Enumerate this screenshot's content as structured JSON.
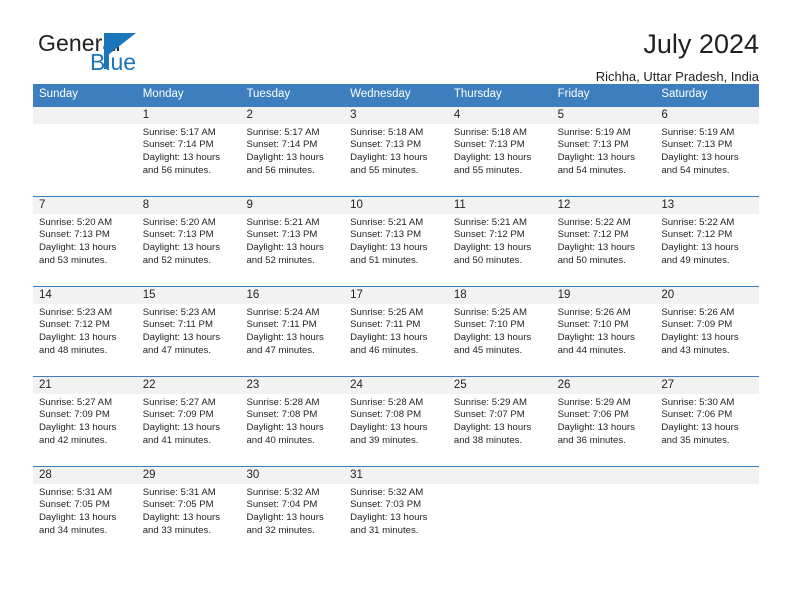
{
  "brand": {
    "name_part1": "General",
    "name_part2": "Blue",
    "logo_icon": "triangle-flag-icon",
    "accent_color": "#1b75bb"
  },
  "header": {
    "title": "July 2024",
    "location": "Richha, Uttar Pradesh, India"
  },
  "theme": {
    "header_blue": "#3d7ebf",
    "day_band_gray": "#f2f2f2",
    "text": "#231f20"
  },
  "calendar": {
    "weekday_headers": [
      "Sunday",
      "Monday",
      "Tuesday",
      "Wednesday",
      "Thursday",
      "Friday",
      "Saturday"
    ],
    "weeks": [
      [
        {
          "day": "",
          "empty": true,
          "sunrise": "",
          "sunset": "",
          "daylight_line1": "",
          "daylight_line2": ""
        },
        {
          "day": "1",
          "sunrise": "Sunrise: 5:17 AM",
          "sunset": "Sunset: 7:14 PM",
          "daylight_line1": "Daylight: 13 hours",
          "daylight_line2": "and 56 minutes."
        },
        {
          "day": "2",
          "sunrise": "Sunrise: 5:17 AM",
          "sunset": "Sunset: 7:14 PM",
          "daylight_line1": "Daylight: 13 hours",
          "daylight_line2": "and 56 minutes."
        },
        {
          "day": "3",
          "sunrise": "Sunrise: 5:18 AM",
          "sunset": "Sunset: 7:13 PM",
          "daylight_line1": "Daylight: 13 hours",
          "daylight_line2": "and 55 minutes."
        },
        {
          "day": "4",
          "sunrise": "Sunrise: 5:18 AM",
          "sunset": "Sunset: 7:13 PM",
          "daylight_line1": "Daylight: 13 hours",
          "daylight_line2": "and 55 minutes."
        },
        {
          "day": "5",
          "sunrise": "Sunrise: 5:19 AM",
          "sunset": "Sunset: 7:13 PM",
          "daylight_line1": "Daylight: 13 hours",
          "daylight_line2": "and 54 minutes."
        },
        {
          "day": "6",
          "sunrise": "Sunrise: 5:19 AM",
          "sunset": "Sunset: 7:13 PM",
          "daylight_line1": "Daylight: 13 hours",
          "daylight_line2": "and 54 minutes."
        }
      ],
      [
        {
          "day": "7",
          "sunrise": "Sunrise: 5:20 AM",
          "sunset": "Sunset: 7:13 PM",
          "daylight_line1": "Daylight: 13 hours",
          "daylight_line2": "and 53 minutes."
        },
        {
          "day": "8",
          "sunrise": "Sunrise: 5:20 AM",
          "sunset": "Sunset: 7:13 PM",
          "daylight_line1": "Daylight: 13 hours",
          "daylight_line2": "and 52 minutes."
        },
        {
          "day": "9",
          "sunrise": "Sunrise: 5:21 AM",
          "sunset": "Sunset: 7:13 PM",
          "daylight_line1": "Daylight: 13 hours",
          "daylight_line2": "and 52 minutes."
        },
        {
          "day": "10",
          "sunrise": "Sunrise: 5:21 AM",
          "sunset": "Sunset: 7:13 PM",
          "daylight_line1": "Daylight: 13 hours",
          "daylight_line2": "and 51 minutes."
        },
        {
          "day": "11",
          "sunrise": "Sunrise: 5:21 AM",
          "sunset": "Sunset: 7:12 PM",
          "daylight_line1": "Daylight: 13 hours",
          "daylight_line2": "and 50 minutes."
        },
        {
          "day": "12",
          "sunrise": "Sunrise: 5:22 AM",
          "sunset": "Sunset: 7:12 PM",
          "daylight_line1": "Daylight: 13 hours",
          "daylight_line2": "and 50 minutes."
        },
        {
          "day": "13",
          "sunrise": "Sunrise: 5:22 AM",
          "sunset": "Sunset: 7:12 PM",
          "daylight_line1": "Daylight: 13 hours",
          "daylight_line2": "and 49 minutes."
        }
      ],
      [
        {
          "day": "14",
          "sunrise": "Sunrise: 5:23 AM",
          "sunset": "Sunset: 7:12 PM",
          "daylight_line1": "Daylight: 13 hours",
          "daylight_line2": "and 48 minutes."
        },
        {
          "day": "15",
          "sunrise": "Sunrise: 5:23 AM",
          "sunset": "Sunset: 7:11 PM",
          "daylight_line1": "Daylight: 13 hours",
          "daylight_line2": "and 47 minutes."
        },
        {
          "day": "16",
          "sunrise": "Sunrise: 5:24 AM",
          "sunset": "Sunset: 7:11 PM",
          "daylight_line1": "Daylight: 13 hours",
          "daylight_line2": "and 47 minutes."
        },
        {
          "day": "17",
          "sunrise": "Sunrise: 5:25 AM",
          "sunset": "Sunset: 7:11 PM",
          "daylight_line1": "Daylight: 13 hours",
          "daylight_line2": "and 46 minutes."
        },
        {
          "day": "18",
          "sunrise": "Sunrise: 5:25 AM",
          "sunset": "Sunset: 7:10 PM",
          "daylight_line1": "Daylight: 13 hours",
          "daylight_line2": "and 45 minutes."
        },
        {
          "day": "19",
          "sunrise": "Sunrise: 5:26 AM",
          "sunset": "Sunset: 7:10 PM",
          "daylight_line1": "Daylight: 13 hours",
          "daylight_line2": "and 44 minutes."
        },
        {
          "day": "20",
          "sunrise": "Sunrise: 5:26 AM",
          "sunset": "Sunset: 7:09 PM",
          "daylight_line1": "Daylight: 13 hours",
          "daylight_line2": "and 43 minutes."
        }
      ],
      [
        {
          "day": "21",
          "sunrise": "Sunrise: 5:27 AM",
          "sunset": "Sunset: 7:09 PM",
          "daylight_line1": "Daylight: 13 hours",
          "daylight_line2": "and 42 minutes."
        },
        {
          "day": "22",
          "sunrise": "Sunrise: 5:27 AM",
          "sunset": "Sunset: 7:09 PM",
          "daylight_line1": "Daylight: 13 hours",
          "daylight_line2": "and 41 minutes."
        },
        {
          "day": "23",
          "sunrise": "Sunrise: 5:28 AM",
          "sunset": "Sunset: 7:08 PM",
          "daylight_line1": "Daylight: 13 hours",
          "daylight_line2": "and 40 minutes."
        },
        {
          "day": "24",
          "sunrise": "Sunrise: 5:28 AM",
          "sunset": "Sunset: 7:08 PM",
          "daylight_line1": "Daylight: 13 hours",
          "daylight_line2": "and 39 minutes."
        },
        {
          "day": "25",
          "sunrise": "Sunrise: 5:29 AM",
          "sunset": "Sunset: 7:07 PM",
          "daylight_line1": "Daylight: 13 hours",
          "daylight_line2": "and 38 minutes."
        },
        {
          "day": "26",
          "sunrise": "Sunrise: 5:29 AM",
          "sunset": "Sunset: 7:06 PM",
          "daylight_line1": "Daylight: 13 hours",
          "daylight_line2": "and 36 minutes."
        },
        {
          "day": "27",
          "sunrise": "Sunrise: 5:30 AM",
          "sunset": "Sunset: 7:06 PM",
          "daylight_line1": "Daylight: 13 hours",
          "daylight_line2": "and 35 minutes."
        }
      ],
      [
        {
          "day": "28",
          "sunrise": "Sunrise: 5:31 AM",
          "sunset": "Sunset: 7:05 PM",
          "daylight_line1": "Daylight: 13 hours",
          "daylight_line2": "and 34 minutes."
        },
        {
          "day": "29",
          "sunrise": "Sunrise: 5:31 AM",
          "sunset": "Sunset: 7:05 PM",
          "daylight_line1": "Daylight: 13 hours",
          "daylight_line2": "and 33 minutes."
        },
        {
          "day": "30",
          "sunrise": "Sunrise: 5:32 AM",
          "sunset": "Sunset: 7:04 PM",
          "daylight_line1": "Daylight: 13 hours",
          "daylight_line2": "and 32 minutes."
        },
        {
          "day": "31",
          "sunrise": "Sunrise: 5:32 AM",
          "sunset": "Sunset: 7:03 PM",
          "daylight_line1": "Daylight: 13 hours",
          "daylight_line2": "and 31 minutes."
        },
        {
          "day": "",
          "empty": true,
          "sunrise": "",
          "sunset": "",
          "daylight_line1": "",
          "daylight_line2": ""
        },
        {
          "day": "",
          "empty": true,
          "sunrise": "",
          "sunset": "",
          "daylight_line1": "",
          "daylight_line2": ""
        },
        {
          "day": "",
          "empty": true,
          "sunrise": "",
          "sunset": "",
          "daylight_line1": "",
          "daylight_line2": ""
        }
      ]
    ]
  }
}
